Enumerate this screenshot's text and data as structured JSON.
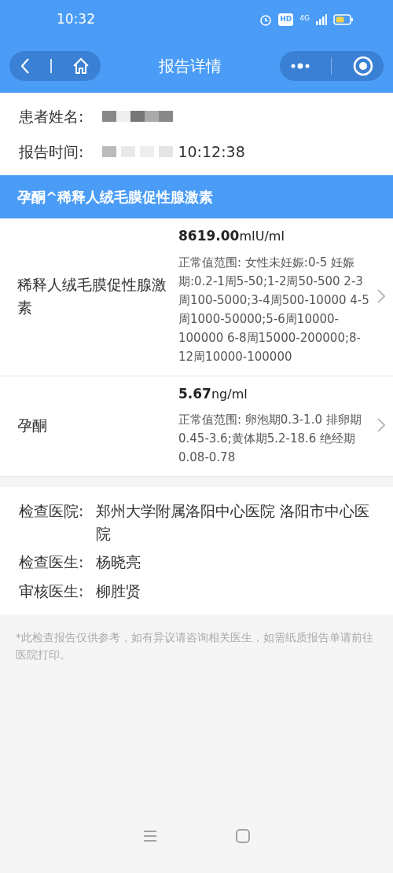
{
  "status_bar": {
    "time": "10:32",
    "hd": "HD",
    "network": "4G"
  },
  "nav_bar": {
    "title": "报告详情"
  },
  "patient": {
    "name_label": "患者姓名:",
    "name_redacted": true,
    "time_label": "报告时间:",
    "time_value": "10:12:38"
  },
  "section": {
    "title": "孕酮^稀释人绒毛膜促性腺激素"
  },
  "results": [
    {
      "name": "稀释人绒毛膜促性腺激素",
      "value": "8619.00",
      "unit": "mIU/ml",
      "range": "正常值范围:  女性未妊娠:0-5 妊娠期:0.2-1周5-50;1-2周50-500 2-3周100-5000;3-4周500-10000 4-5周1000-50000;5-6周10000-100000 6-8周15000-200000;8-12周10000-100000"
    },
    {
      "name": "孕酮",
      "value": "5.67",
      "unit": "ng/ml",
      "range": "正常值范围:  卵泡期0.3-1.0 排卵期0.45-3.6;黄体期5.2-18.6 绝经期0.08-0.78"
    }
  ],
  "info": [
    {
      "label": "检查医院:",
      "value": "郑州大学附属洛阳中心医院 洛阳市中心医院"
    },
    {
      "label": "检查医生:",
      "value": "杨晓亮"
    },
    {
      "label": "审核医生:",
      "value": "柳胜贤"
    }
  ],
  "footnote": "*此检查报告仅供参考，如有异议请咨询相关医生，如需纸质报告单请前往医院打印。"
}
